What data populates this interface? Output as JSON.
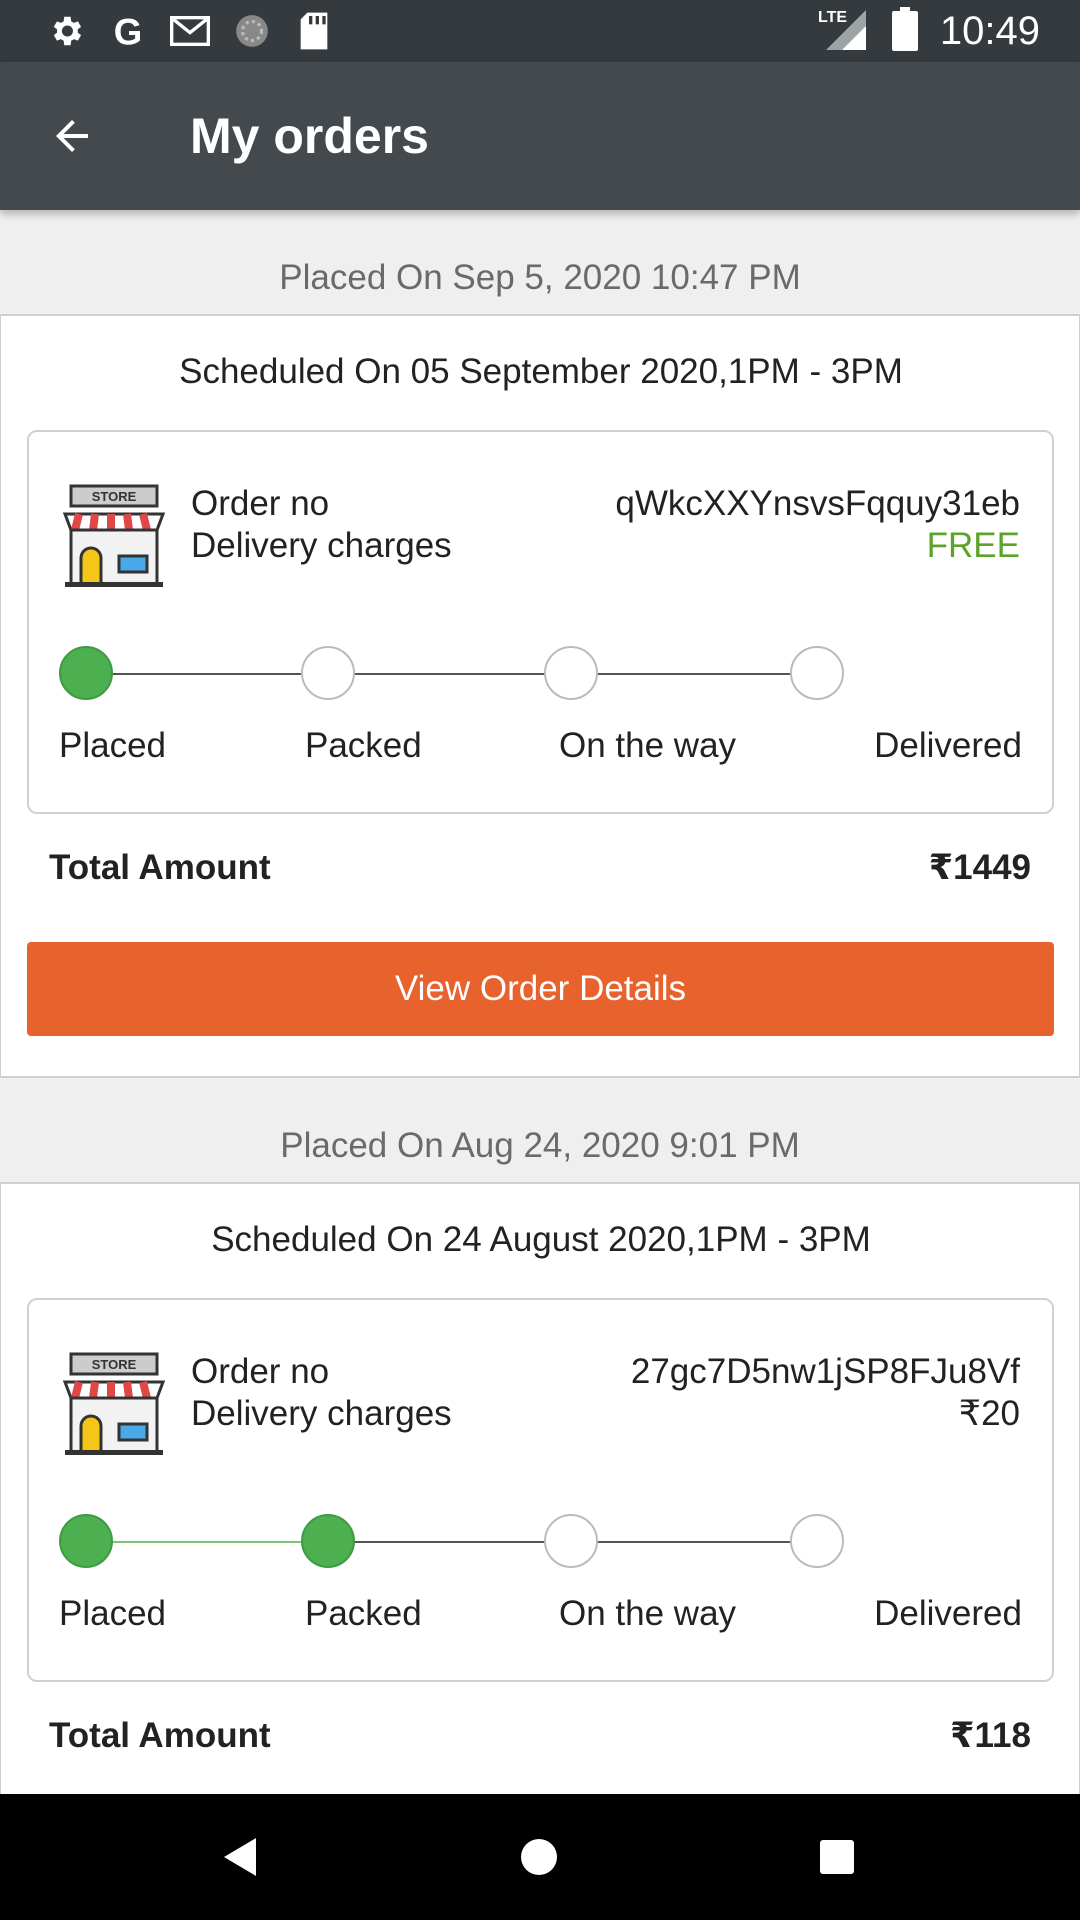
{
  "statusbar": {
    "time": "10:49",
    "network": "LTE",
    "icons": [
      "settings-icon",
      "google-icon",
      "gmail-icon",
      "sync-icon",
      "sd-card-icon",
      "signal-icon",
      "battery-icon"
    ]
  },
  "appbar": {
    "title": "My orders",
    "back_icon": "arrow-left-icon"
  },
  "stages": [
    "Placed",
    "Packed",
    "On the way",
    "Delivered"
  ],
  "labels": {
    "order_no": "Order no",
    "delivery_charges": "Delivery charges",
    "total_amount": "Total Amount",
    "view_details": "View Order Details"
  },
  "orders": [
    {
      "placed_on": "Placed On Sep 5, 2020 10:47 PM",
      "scheduled": "Scheduled On 05 September 2020,1PM - 3PM",
      "order_no": "qWkcXXYnsvsFqquy31eb",
      "delivery_charges": "FREE",
      "progress_stage": 1,
      "total": "₹1449"
    },
    {
      "placed_on": "Placed On Aug 24, 2020 9:01 PM",
      "scheduled": "Scheduled On 24 August 2020,1PM - 3PM",
      "order_no": "27gc7D5nw1jSP8FJu8Vf",
      "delivery_charges": "₹20",
      "progress_stage": 2,
      "total": "₹118"
    }
  ],
  "colors": {
    "appbar": "#43494d",
    "statusbar": "#353a3e",
    "accent": "#e8622e",
    "done": "#4caf50",
    "free": "#5ca329"
  }
}
